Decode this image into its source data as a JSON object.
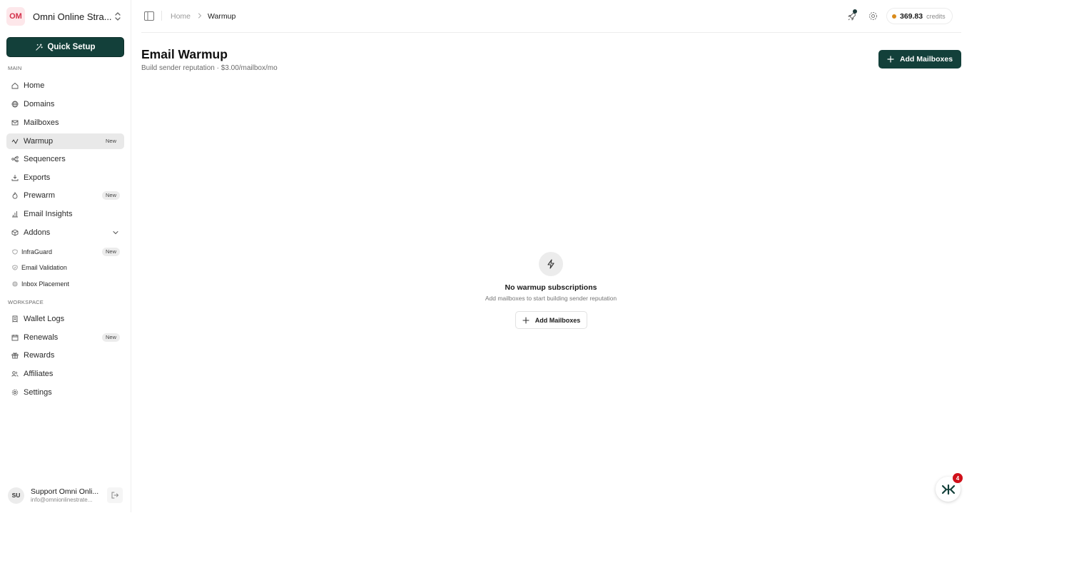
{
  "workspace": {
    "initials": "OM",
    "name": "Omni Online Stra..."
  },
  "quick_setup_label": "Quick Setup",
  "sections": {
    "main": "MAIN",
    "workspace": "WORKSPACE"
  },
  "nav": {
    "home": "Home",
    "domains": "Domains",
    "mailboxes": "Mailboxes",
    "warmup": "Warmup",
    "sequencers": "Sequencers",
    "exports": "Exports",
    "prewarm": "Prewarm",
    "email_insights": "Email Insights",
    "addons": "Addons",
    "infraguard": "InfraGuard",
    "email_validation": "Email Validation",
    "inbox_placement": "Inbox Placement",
    "wallet_logs": "Wallet Logs",
    "renewals": "Renewals",
    "rewards": "Rewards",
    "affiliates": "Affiliates",
    "settings": "Settings",
    "badge_new": "New"
  },
  "user": {
    "initials": "SU",
    "name": "Support Omni Onli...",
    "email": "info@omnionlinestrate..."
  },
  "breadcrumb": {
    "home": "Home",
    "current": "Warmup"
  },
  "credits": {
    "amount": "369.83",
    "unit": "credits"
  },
  "page": {
    "title": "Email Warmup",
    "subtitle": "Build sender reputation · $3.00/mailbox/mo",
    "add_button": "Add Mailboxes"
  },
  "empty": {
    "title": "No warmup subscriptions",
    "subtitle": "Add mailboxes to start building sender reputation",
    "button": "Add Mailboxes"
  },
  "widget": {
    "badge_count": "4"
  },
  "colors": {
    "brand": "#13403a",
    "credit_dot": "#d98a1a",
    "badge_red": "#d0101a",
    "workspace_avatar": "#fde7ea"
  }
}
